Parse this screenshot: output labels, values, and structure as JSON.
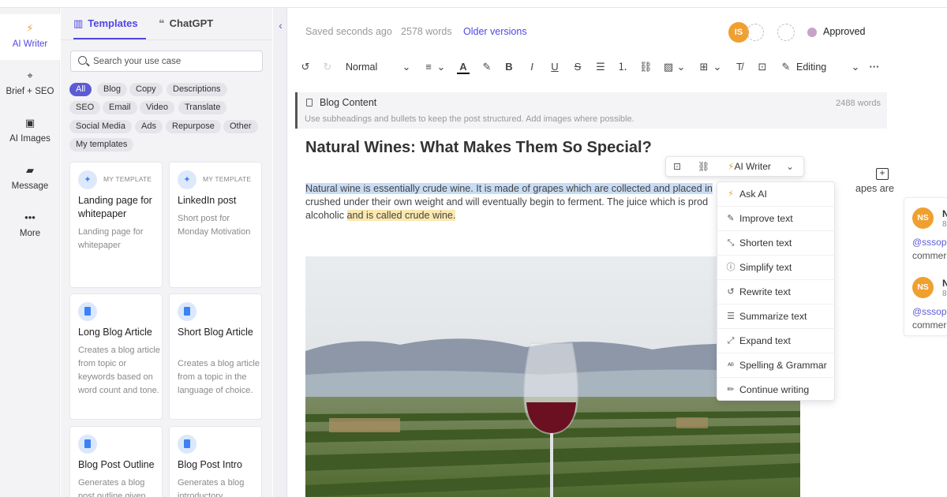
{
  "rail": {
    "items": [
      {
        "label": "AI Writer",
        "icon": "lightning-icon"
      },
      {
        "label": "Brief + SEO",
        "icon": "target-icon"
      },
      {
        "label": "AI Images",
        "icon": "image-icon"
      },
      {
        "label": "Message",
        "icon": "chat-icon"
      },
      {
        "label": "More",
        "icon": "more-dots-icon"
      }
    ]
  },
  "panel": {
    "tabs": [
      {
        "label": "Templates",
        "icon": "templates-icon"
      },
      {
        "label": "ChatGPT",
        "icon": "chat-bubbles-icon"
      }
    ],
    "search": {
      "placeholder": "Search your use case"
    },
    "chips": [
      "All",
      "Blog",
      "Copy",
      "Descriptions",
      "SEO",
      "Email",
      "Video",
      "Translate",
      "Social Media",
      "Ads",
      "Repurpose",
      "Other",
      "My templates"
    ],
    "cards": [
      {
        "tag": "MY TEMPLATE",
        "title": "Landing page for whitepaper",
        "desc": "Landing page for whitepaper"
      },
      {
        "tag": "MY TEMPLATE",
        "title": "LinkedIn post",
        "desc": "Short post for Monday Motivation"
      },
      {
        "tag": "",
        "title": "Long Blog Article",
        "desc": "Creates a blog article from topic or keywords based on word count and tone."
      },
      {
        "tag": "",
        "title": "Short Blog Article",
        "desc": "Creates a blog article from a topic in the language of choice."
      },
      {
        "tag": "",
        "title": "Blog Post Outline",
        "desc": "Generates a blog post outline given"
      },
      {
        "tag": "",
        "title": "Blog Post Intro",
        "desc": "Generates a blog introductory"
      }
    ]
  },
  "header": {
    "saved": "Saved seconds ago",
    "words": "2578 words",
    "older": "Older versions",
    "avatar": "IS",
    "status": "Approved"
  },
  "toolbar": {
    "style": "Normal",
    "mode": "Editing"
  },
  "block": {
    "title": "Blog Content",
    "words": "2488 words",
    "hint": "Use subheadings and bullets to keep the post structured. Add images where possible."
  },
  "doc": {
    "title": "Natural Wines: What Makes Them So Special?",
    "p1_selected": "Natural wine is essentially crude wine. It is made of grapes which are collected and placed in",
    "p1_rest": "apes are",
    "p1_line2": "crushed under their own weight and will eventually begin to ferment. The juice which is prod",
    "p1_line3a": "alcoholic ",
    "p1_line3b": "and is called crude wine."
  },
  "aibar": {
    "label": "AI Writer"
  },
  "menu": {
    "items": [
      {
        "label": "Ask AI",
        "icon": "lightning-icon"
      },
      {
        "label": "Improve text",
        "icon": "edit-box-icon"
      },
      {
        "label": "Shorten text",
        "icon": "shrink-icon"
      },
      {
        "label": "Simplify text",
        "icon": "info-circle-icon"
      },
      {
        "label": "Rewrite text",
        "icon": "undo-icon"
      },
      {
        "label": "Summarize text",
        "icon": "list-icon"
      },
      {
        "label": "Expand text",
        "icon": "expand-icon"
      },
      {
        "label": "Spelling & Grammar",
        "icon": "spellcheck-icon"
      },
      {
        "label": "Continue writing",
        "icon": "pencil-icon"
      }
    ]
  },
  "comments": [
    {
      "avatar": "NS",
      "name": "N",
      "date": "8",
      "mention": "@sssopl",
      "text": "commer"
    },
    {
      "avatar": "NS",
      "name": "N",
      "date": "8",
      "mention": "@sssopl",
      "text": "commer"
    }
  ],
  "colors": {
    "accent": "#4f46e5",
    "chip_active": "#5b5bd6",
    "avatar": "#f0a030",
    "approved": "#c8a2c8"
  }
}
